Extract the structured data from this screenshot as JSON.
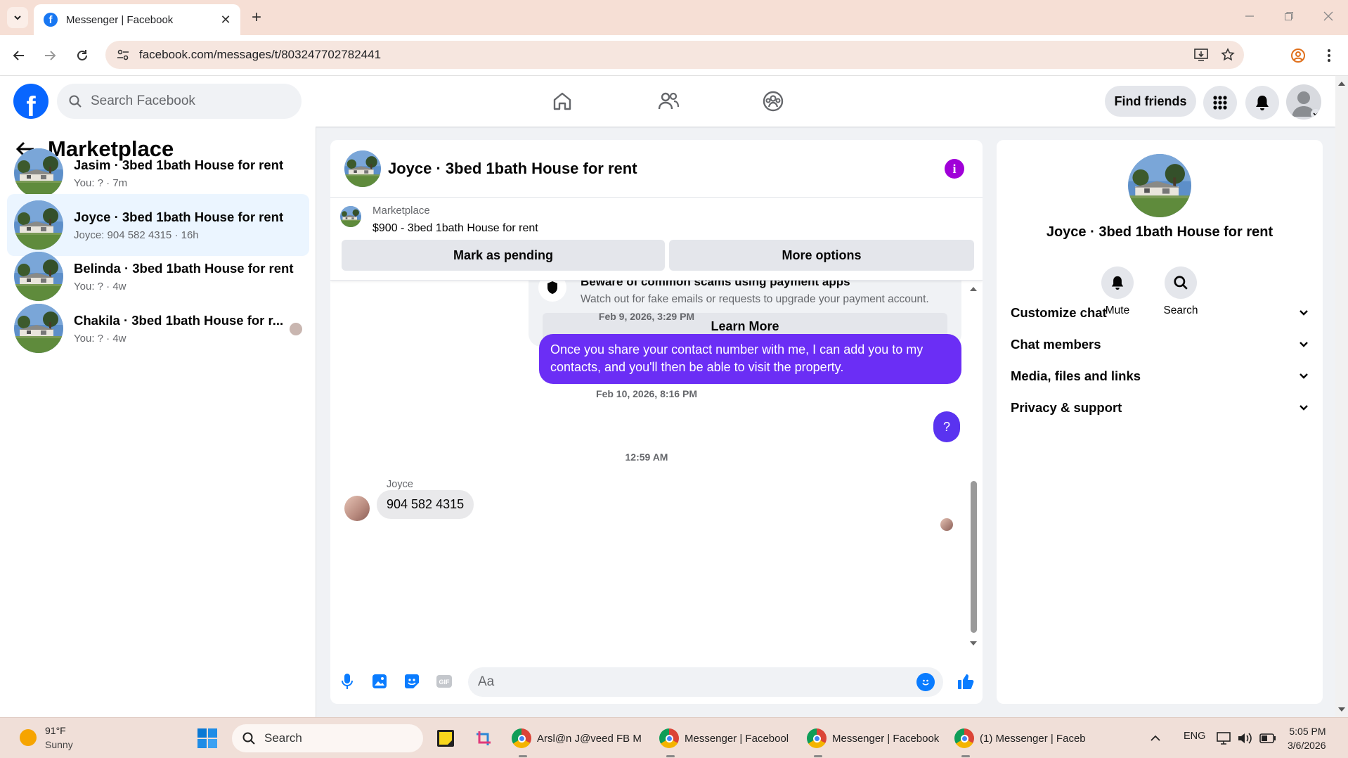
{
  "browser": {
    "tab_title": "Messenger | Facebook",
    "new_tab_symbol": "+",
    "close_symbol": "✕",
    "url": "facebook.com/messages/t/803247702782441"
  },
  "fb": {
    "logo_letter": "f",
    "search_placeholder": "Search Facebook",
    "find_friends": "Find friends",
    "brand_color": "#0866ff"
  },
  "sidebar": {
    "title": "Marketplace",
    "conversations": [
      {
        "name": "Jasim · 3bed 1bath House for rent",
        "preview": "You: ? · 7m",
        "active": false
      },
      {
        "name": "Joyce · 3bed 1bath House for rent",
        "preview": "Joyce: 904 582 4315 · 16h",
        "active": true
      },
      {
        "name": "Belinda · 3bed 1bath House for rent",
        "preview": "You: ? · 4w",
        "active": false
      },
      {
        "name": "Chakila · 3bed 1bath House for r...",
        "preview": "You: ? · 4w",
        "active": false
      }
    ]
  },
  "chat": {
    "title": "Joyce · 3bed 1bath House for rent",
    "listing": {
      "source": "Marketplace",
      "price_title": "$900 - 3bed 1bath House for rent",
      "mark_pending": "Mark as pending",
      "more_options": "More options"
    },
    "scam_notice": {
      "title": "Beware of common scams using payment apps",
      "description": "Watch out for fake emails or requests to upgrade your payment account.",
      "button": "Learn More"
    },
    "messages": [
      {
        "timestamp": "Feb 9, 2026, 3:29 PM"
      },
      {
        "outgoing": "Once you share your contact number with me, I can add you to my contacts, and you'll then be able to visit the property."
      },
      {
        "timestamp": "Feb 10, 2026, 8:16 PM"
      },
      {
        "outgoing": "?"
      },
      {
        "timestamp": "12:59 AM"
      },
      {
        "sender": "Joyce",
        "incoming": "904 582 4315"
      }
    ],
    "composer_placeholder": "Aa",
    "accent_color": "#6b2ef5"
  },
  "details": {
    "title": "Joyce · 3bed 1bath House for rent",
    "actions": [
      {
        "label": "Mute",
        "icon": "bell-icon"
      },
      {
        "label": "Search",
        "icon": "search-icon"
      }
    ],
    "sections": [
      "Customize chat",
      "Chat members",
      "Media, files and links",
      "Privacy & support"
    ]
  },
  "taskbar": {
    "weather_temp": "91°F",
    "weather_desc": "Sunny",
    "search_label": "Search",
    "apps": [
      {
        "label": "Arsl@n J@veed FB M"
      },
      {
        "label": "Messenger | Facebool"
      },
      {
        "label": "Messenger | Facebook"
      },
      {
        "label": "(1) Messenger | Faceb"
      }
    ],
    "language": "ENG",
    "time": "5:05 PM",
    "date": "3/6/2026"
  }
}
